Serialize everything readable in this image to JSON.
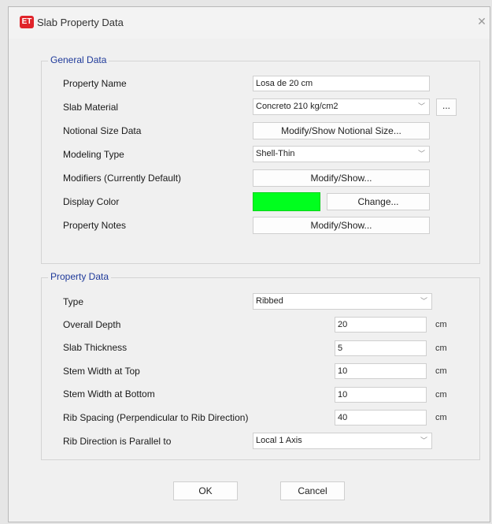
{
  "window": {
    "title": "Slab Property Data",
    "app_icon": "ET"
  },
  "general": {
    "label": "General Data",
    "property_name_label": "Property Name",
    "property_name_value": "Losa de 20 cm",
    "slab_material_label": "Slab Material",
    "slab_material_value": "Concreto 210 kg/cm2",
    "slab_material_more": "...",
    "notional_label": "Notional Size Data",
    "notional_button": "Modify/Show Notional Size...",
    "modeling_type_label": "Modeling Type",
    "modeling_type_value": "Shell-Thin",
    "modifiers_label": "Modifiers (Currently Default)",
    "modifiers_button": "Modify/Show...",
    "display_color_label": "Display Color",
    "display_color_value": "#00ff1e",
    "change_button": "Change...",
    "notes_label": "Property Notes",
    "notes_button": "Modify/Show..."
  },
  "property": {
    "label": "Property Data",
    "type_label": "Type",
    "type_value": "Ribbed",
    "rows": [
      {
        "label": "Overall Depth",
        "value": "20",
        "unit": "cm"
      },
      {
        "label": "Slab Thickness",
        "value": "5",
        "unit": "cm"
      },
      {
        "label": "Stem Width at Top",
        "value": "10",
        "unit": "cm"
      },
      {
        "label": "Stem Width at Bottom",
        "value": "10",
        "unit": "cm"
      },
      {
        "label": "Rib Spacing (Perpendicular to Rib Direction)",
        "value": "40",
        "unit": "cm"
      }
    ],
    "rib_dir_label": "Rib Direction is Parallel to",
    "rib_dir_value": "Local 1 Axis"
  },
  "buttons": {
    "ok": "OK",
    "cancel": "Cancel"
  }
}
